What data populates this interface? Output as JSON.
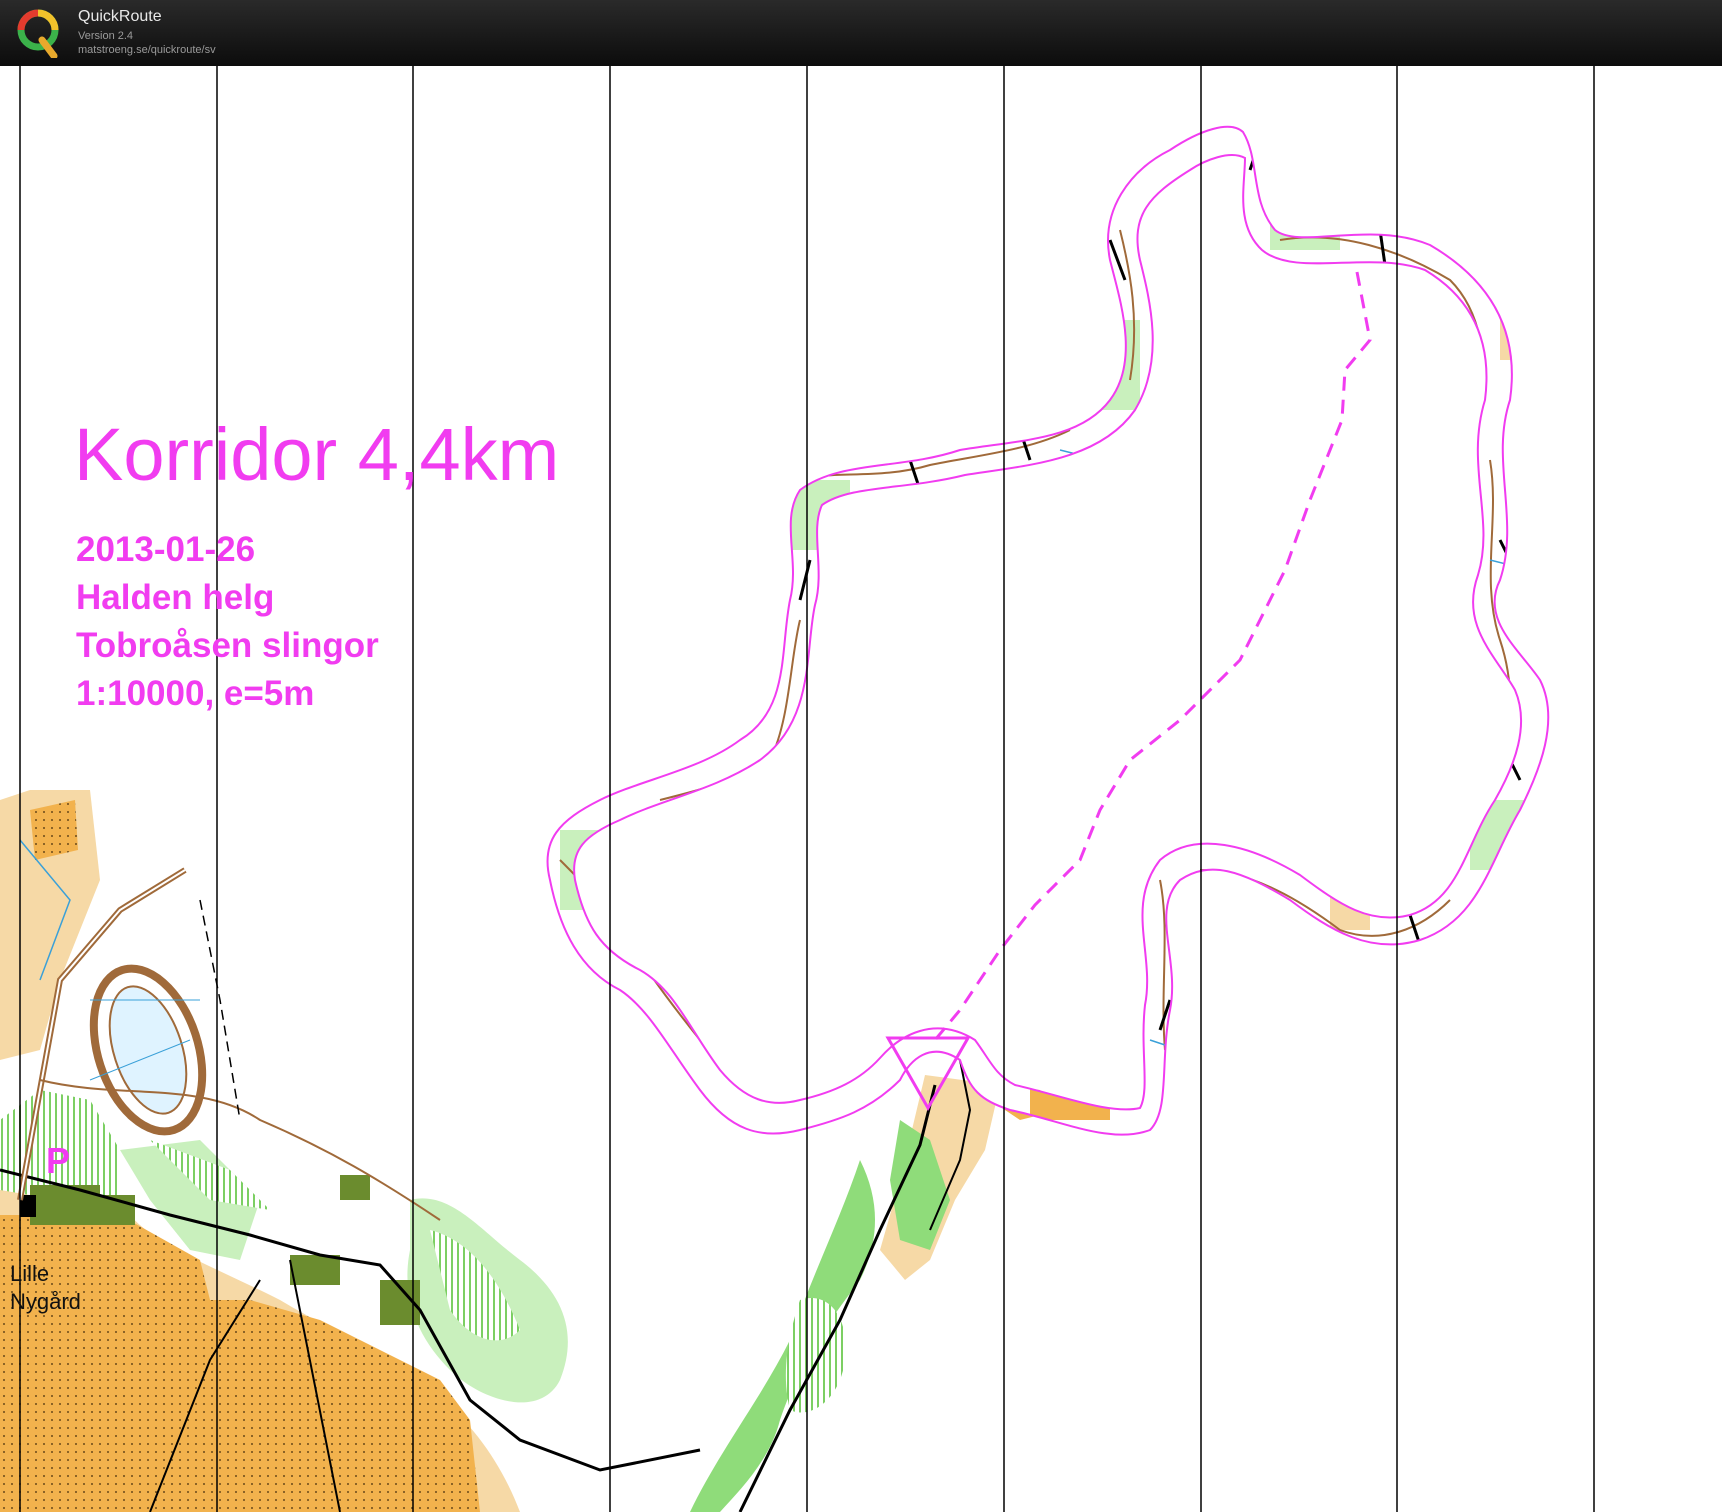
{
  "app": {
    "name": "QuickRoute",
    "version": "Version 2.4",
    "url": "matstroeng.se/quickroute/sv"
  },
  "map": {
    "title": "Korridor 4,4km",
    "date": "2013-01-26",
    "event": "Halden helg",
    "area": "Tobroåsen slingor",
    "scale": "1:10000, e=5m",
    "parking_symbol": "P",
    "place_name_line1": "Lille",
    "place_name_line2": "Nygård"
  },
  "colors": {
    "course": "#f13cf0",
    "open_land": "#f2b24d",
    "forest_green": "#8fdc7a",
    "building": "#6b8c2e",
    "grid_lines": "#000000",
    "title_bar": "#111111"
  },
  "icons": [
    "quickroute-logo",
    "start-triangle",
    "parking-sign"
  ]
}
